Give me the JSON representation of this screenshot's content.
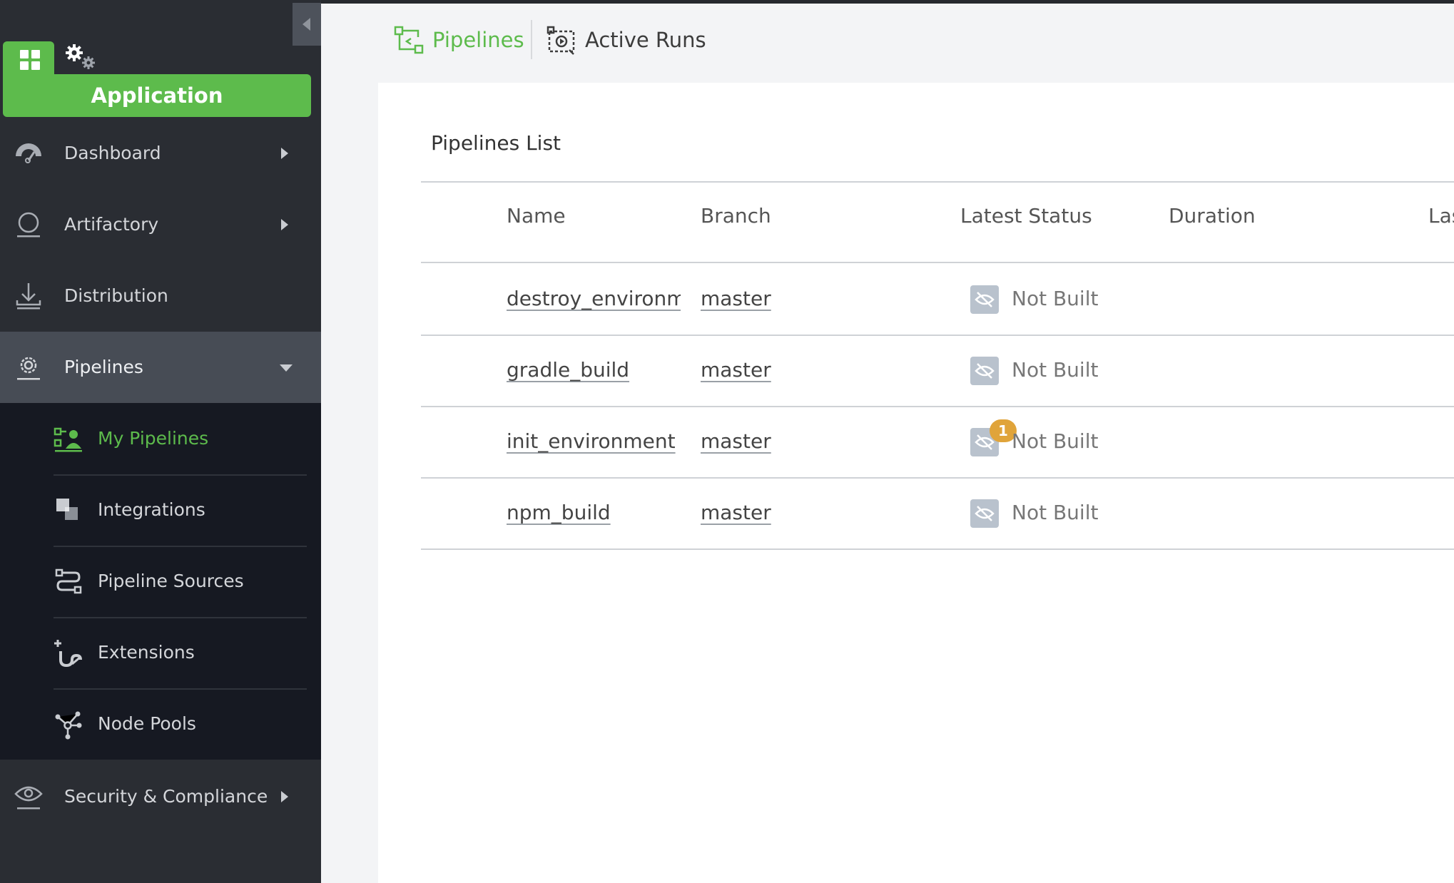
{
  "sidebar": {
    "app_label": "Application",
    "items": [
      {
        "label": "Dashboard"
      },
      {
        "label": "Artifactory"
      },
      {
        "label": "Distribution"
      },
      {
        "label": "Pipelines"
      },
      {
        "label": "Security & Compliance"
      }
    ],
    "sub_items": [
      {
        "label": "My Pipelines"
      },
      {
        "label": "Integrations"
      },
      {
        "label": "Pipeline Sources"
      },
      {
        "label": "Extensions"
      },
      {
        "label": "Node Pools"
      }
    ]
  },
  "tabs": [
    {
      "label": "Pipelines"
    },
    {
      "label": "Active Runs"
    }
  ],
  "main": {
    "title": "Pipelines List",
    "columns": [
      "Name",
      "Branch",
      "Latest Status",
      "Duration",
      "Las"
    ],
    "rows": [
      {
        "name": "destroy_environme",
        "branch": "master",
        "status": "Not Built"
      },
      {
        "name": "gradle_build",
        "branch": "master",
        "status": "Not Built"
      },
      {
        "name": "init_environment",
        "branch": "master",
        "status": "Not Built",
        "badge": "1"
      },
      {
        "name": "npm_build",
        "branch": "master",
        "status": "Not Built"
      }
    ]
  },
  "colors": {
    "accent": "#5dbb4c",
    "sidebar_bg": "#2a2d33",
    "subnav_bg": "#161922",
    "badge": "#e0a43a"
  }
}
